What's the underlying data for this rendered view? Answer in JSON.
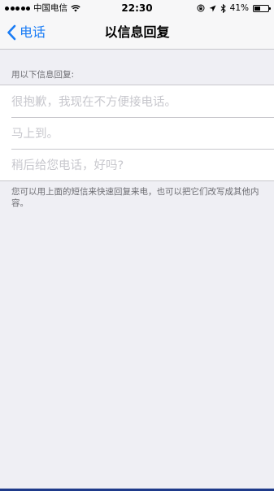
{
  "status_bar": {
    "carrier": "中国电信",
    "time": "22:30",
    "battery_percent": "41%",
    "battery_level": 0.41,
    "signal_bars": 5
  },
  "nav": {
    "back_label": "电话",
    "title": "以信息回复"
  },
  "section": {
    "header": "用以下信息回复:",
    "items": [
      {
        "placeholder": "很抱歉，我现在不方便接电话。"
      },
      {
        "placeholder": "马上到。"
      },
      {
        "placeholder": "稍后给您电话，好吗?"
      }
    ],
    "footer": "您可以用上面的短信来快速回复来电，也可以把它们改写成其他内容。"
  },
  "colors": {
    "accent": "#1a7cf5",
    "background": "#efeff4",
    "separator": "#c8c7cc",
    "placeholder": "#c7c7cd",
    "secondary_text": "#6d6d72"
  }
}
